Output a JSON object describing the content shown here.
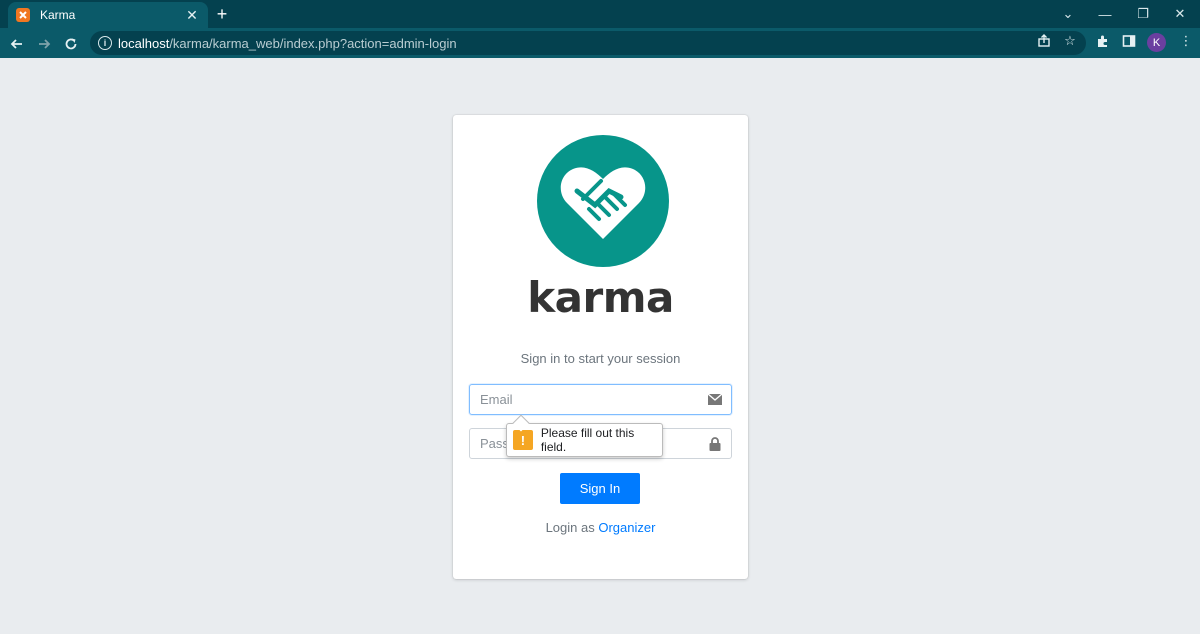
{
  "browser": {
    "tab_title": "Karma",
    "url_host": "localhost",
    "url_path": "/karma/karma_web/index.php?action=admin-login",
    "profile_initial": "K"
  },
  "card": {
    "brand": "karma",
    "message": "Sign in to start your session",
    "email_placeholder": "Email",
    "password_placeholder": "Password",
    "signin_label": "Sign In",
    "login_as_prefix": "Login as",
    "login_as_link": "Organizer",
    "validation_message": "Please fill out this field."
  },
  "colors": {
    "logo": "#07958a",
    "primary": "#007bff",
    "page_bg": "#e9ecef"
  },
  "icons": [
    "xampp-favicon",
    "close-icon",
    "plus-icon",
    "back-icon",
    "forward-icon",
    "reload-icon",
    "info-icon",
    "share-icon",
    "star-icon",
    "extensions-icon",
    "sidepanel-icon",
    "menu-icon",
    "envelope-icon",
    "lock-icon",
    "warning-icon",
    "handshake-heart-icon"
  ]
}
